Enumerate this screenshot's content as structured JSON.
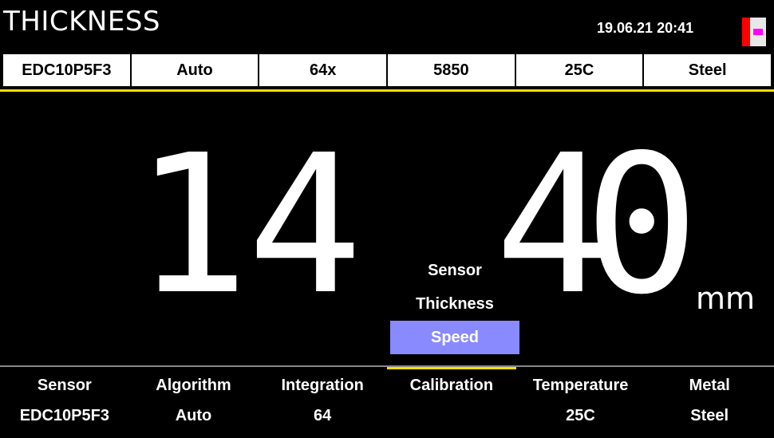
{
  "header": {
    "title": "THICKNESS",
    "date": "19.06.21",
    "time": "20:41"
  },
  "status_bar": [
    "EDC10P5F3",
    "Auto",
    "64x",
    "5850",
    "25C",
    "Steel"
  ],
  "reading": {
    "digit_1": "1",
    "digit_2": "4",
    "digit_3": "4",
    "digit_4": "0",
    "unit": "mm"
  },
  "popup_menu": {
    "items": [
      "Sensor",
      "Thickness",
      "Speed"
    ],
    "selected": "Speed"
  },
  "bottom_bar": [
    {
      "label": "Sensor",
      "value": "EDC10P5F3"
    },
    {
      "label": "Algorithm",
      "value": "Auto"
    },
    {
      "label": "Integration",
      "value": "64"
    },
    {
      "label": "Calibration",
      "value": ""
    },
    {
      "label": "Temperature",
      "value": "25C"
    },
    {
      "label": "Metal",
      "value": "Steel"
    }
  ],
  "colors": {
    "background": "#000000",
    "accent_yellow": "#f0e000",
    "selected_item": "#8a8aff",
    "battery_red": "#ff0000",
    "battery_magenta": "#ff00ff"
  }
}
